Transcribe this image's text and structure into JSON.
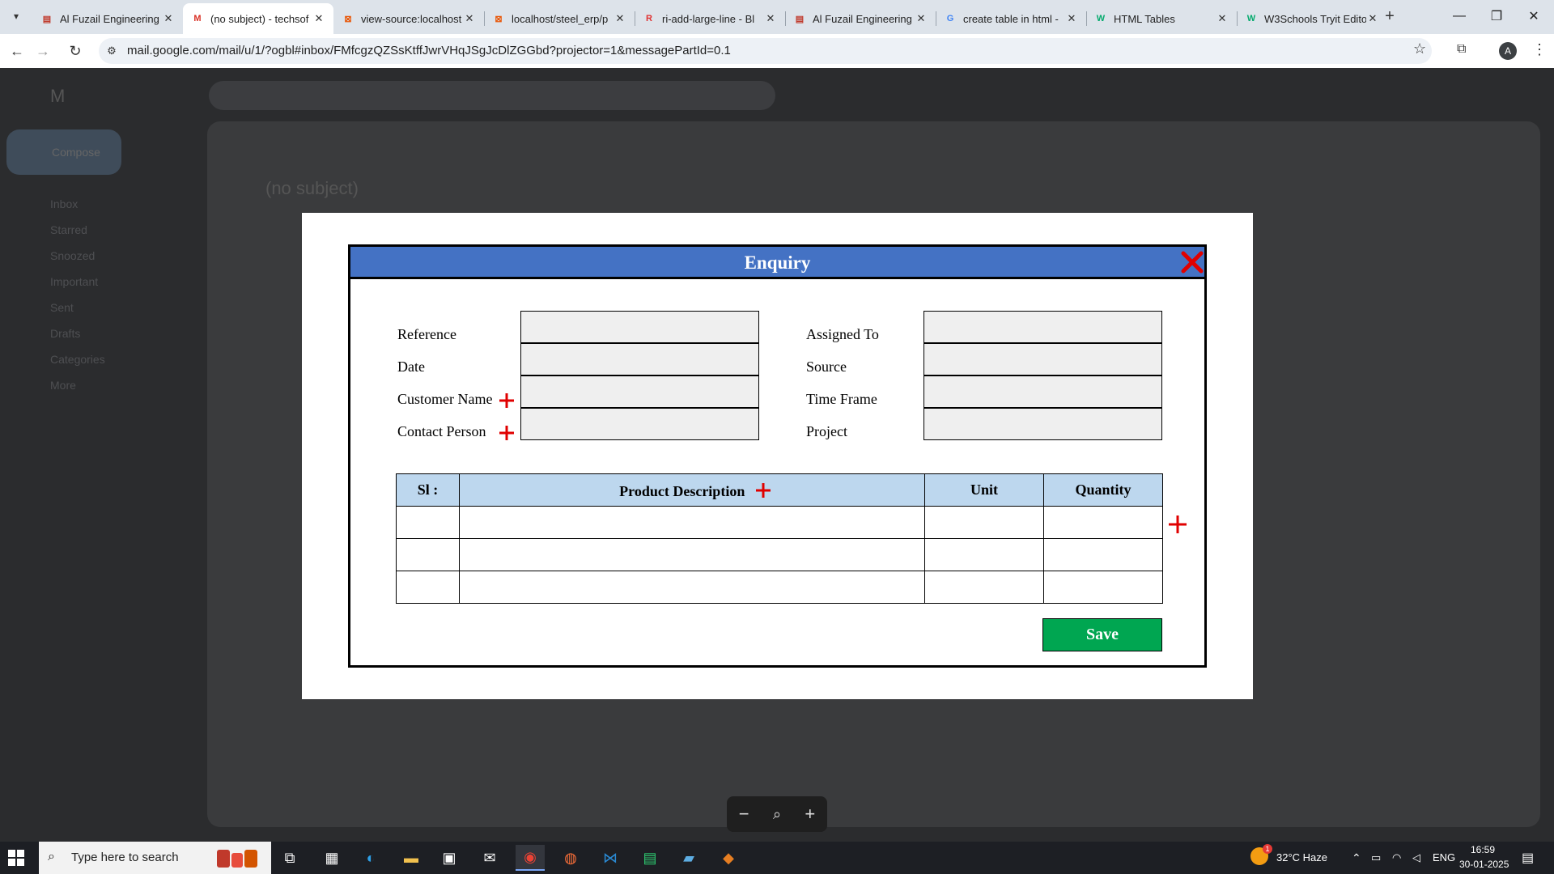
{
  "browser": {
    "tabs": [
      {
        "title": "Al Fuzail Engineering",
        "favicon": "document-icon",
        "color": "#c0392b",
        "active": false
      },
      {
        "title": "(no subject) - techsof",
        "favicon": "gmail-icon",
        "color": "#d93025",
        "active": true
      },
      {
        "title": "view-source:localhost",
        "favicon": "xampp-icon",
        "color": "#e8590c",
        "active": false
      },
      {
        "title": "localhost/steel_erp/p",
        "favicon": "xampp-icon",
        "color": "#e8590c",
        "active": false
      },
      {
        "title": "ri-add-large-line - Bl",
        "favicon": "remix-icon",
        "color": "#e03131",
        "active": false
      },
      {
        "title": "Al Fuzail Engineering",
        "favicon": "document-icon",
        "color": "#c0392b",
        "active": false
      },
      {
        "title": "create table in html -",
        "favicon": "google-icon",
        "color": "#4285f4",
        "active": false
      },
      {
        "title": "HTML Tables",
        "favicon": "w3schools-icon",
        "color": "#04aa6d",
        "active": false
      },
      {
        "title": "W3Schools Tryit Edito",
        "favicon": "w3schools-icon",
        "color": "#04aa6d",
        "active": false
      }
    ],
    "url": "mail.google.com/mail/u/1/?ogbl#inbox/FMfcgzQZSsKtffJwrVHqJSgJcDlZGGbd?projector=1&messagePartId=0.1",
    "profile_initial": "A"
  },
  "gmail_background": {
    "compose_label": "Compose",
    "subject": "(no subject)",
    "nav": [
      "Inbox",
      "Starred",
      "Snoozed",
      "Important",
      "Sent",
      "Drafts",
      "Categories",
      "More"
    ]
  },
  "form": {
    "title": "Enquiry",
    "colors": {
      "header": "#4472c4",
      "table_header": "#bdd7ee",
      "save": "#00a651",
      "accent": "#e00000"
    },
    "left_fields": [
      "Reference",
      "Date",
      "Customer Name",
      "Contact Person"
    ],
    "right_fields": [
      "Assigned To",
      "Source",
      "Time Frame",
      "Project"
    ],
    "table": {
      "headers": [
        "Sl :",
        "Product Description",
        "Unit",
        "Quantity"
      ],
      "rows": 3
    },
    "save_label": "Save"
  },
  "taskbar": {
    "search_placeholder": "Type here to search",
    "weather": "32°C Haze",
    "language": "ENG",
    "time": "16:59",
    "date": "30-01-2025",
    "weather_badge": "1"
  }
}
